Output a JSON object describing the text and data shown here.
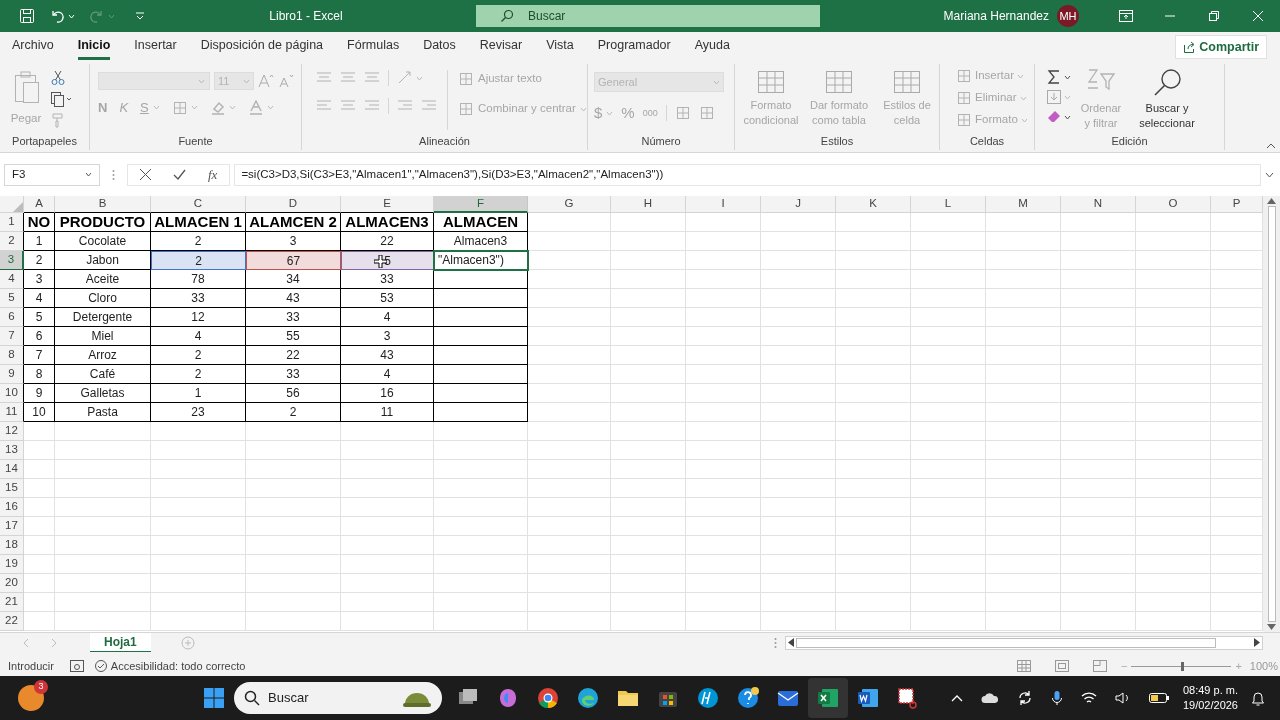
{
  "title_bar": {
    "title": "Libro1  -  Excel",
    "search_placeholder": "Buscar",
    "user": "Mariana Hernandez",
    "initials": "MH",
    "redo_disabled": true
  },
  "menu_tabs": [
    {
      "label": "Archivo",
      "selected": false
    },
    {
      "label": "Inicio",
      "selected": true
    },
    {
      "label": "Insertar",
      "selected": false
    },
    {
      "label": "Disposición de página",
      "selected": false
    },
    {
      "label": "Fórmulas",
      "selected": false
    },
    {
      "label": "Datos",
      "selected": false
    },
    {
      "label": "Revisar",
      "selected": false
    },
    {
      "label": "Vista",
      "selected": false
    },
    {
      "label": "Programador",
      "selected": false
    },
    {
      "label": "Ayuda",
      "selected": false
    }
  ],
  "share_button": "Compartir",
  "ribbon": {
    "groups": [
      {
        "label": "Portapapeles",
        "buttons": [
          {
            "label": "Pegar",
            "disabled": true
          }
        ]
      },
      {
        "label": "Fuente",
        "font_size": "11",
        "buttons": [
          {
            "label": "N",
            "disabled": true
          },
          {
            "label": "K",
            "disabled": true
          },
          {
            "label": "S",
            "disabled": true
          }
        ]
      },
      {
        "label": "Alineación",
        "buttons": [
          {
            "label": "Ajustar texto",
            "disabled": true
          },
          {
            "label": "Combinar y centrar",
            "disabled": true
          }
        ]
      },
      {
        "label": "Número",
        "format": "General",
        "buttons": [
          {
            "label": "$",
            "disabled": true
          },
          {
            "label": "%",
            "disabled": true
          },
          {
            "label": "000",
            "disabled": true
          }
        ]
      },
      {
        "label": "Estilos",
        "buttons": [
          {
            "label": "Formato condicional",
            "disabled": true
          },
          {
            "label": "Dar formato como tabla",
            "disabled": true
          },
          {
            "label": "Estilos de celda",
            "disabled": true
          }
        ]
      },
      {
        "label": "Celdas",
        "buttons": [
          {
            "label": "Insertar",
            "disabled": true
          },
          {
            "label": "Eliminar",
            "disabled": true
          },
          {
            "label": "Formato",
            "disabled": true
          }
        ]
      },
      {
        "label": "Edición",
        "buttons": [
          {
            "label": "Ordenar y filtrar",
            "disabled": true
          },
          {
            "label": "Buscar y seleccionar",
            "disabled": false
          }
        ]
      }
    ]
  },
  "formula_bar": {
    "name_box": "F3",
    "function_label": "fx",
    "formula": "=si(C3>D3,Si(C3>E3,\"Almacen1\",\"Almacen3\"),Si(D3>E3,\"Almacen2\",\"Almacen3\"))"
  },
  "grid": {
    "columns": [
      {
        "label": "A",
        "selected": false
      },
      {
        "label": "B",
        "selected": false
      },
      {
        "label": "C",
        "selected": false
      },
      {
        "label": "D",
        "selected": false
      },
      {
        "label": "E",
        "selected": false
      },
      {
        "label": "F",
        "selected": true
      },
      {
        "label": "G",
        "selected": false
      },
      {
        "label": "H",
        "selected": false
      },
      {
        "label": "I",
        "selected": false
      },
      {
        "label": "J",
        "selected": false
      },
      {
        "label": "K",
        "selected": false
      },
      {
        "label": "L",
        "selected": false
      },
      {
        "label": "M",
        "selected": false
      },
      {
        "label": "N",
        "selected": false
      },
      {
        "label": "O",
        "selected": false
      },
      {
        "label": "P",
        "selected": false
      }
    ],
    "rows": [
      {
        "header": "1",
        "selected": false,
        "kind": "heading",
        "cells": [
          {
            "text": "NO"
          },
          {
            "text": "PRODUCTO"
          },
          {
            "text": "ALMACEN 1"
          },
          {
            "text": "ALAMCEN 2"
          },
          {
            "text": "ALMACEN3"
          },
          {
            "text": "ALMACEN"
          }
        ]
      },
      {
        "header": "2",
        "selected": false,
        "kind": "data",
        "cells": [
          {
            "text": "1"
          },
          {
            "text": "Cocolate"
          },
          {
            "text": "2"
          },
          {
            "text": "3"
          },
          {
            "text": "22"
          },
          {
            "text": "Almacen3"
          }
        ]
      },
      {
        "header": "3",
        "selected": true,
        "kind": "data",
        "cells": [
          {
            "text": "2"
          },
          {
            "text": "Jabon"
          },
          {
            "text": "2",
            "color": "#4472c4"
          },
          {
            "text": "67",
            "color": "#c0504d"
          },
          {
            "text": "5",
            "color": "#8064a2"
          },
          {
            "text": "\"Almacen3\")"
          }
        ]
      },
      {
        "header": "4",
        "selected": false,
        "kind": "data",
        "cells": [
          {
            "text": "3"
          },
          {
            "text": "Aceite"
          },
          {
            "text": "78"
          },
          {
            "text": "34"
          },
          {
            "text": "33"
          }
        ]
      },
      {
        "header": "5",
        "selected": false,
        "kind": "data",
        "cells": [
          {
            "text": "4"
          },
          {
            "text": "Cloro"
          },
          {
            "text": "33"
          },
          {
            "text": "43"
          },
          {
            "text": "53"
          }
        ]
      },
      {
        "header": "6",
        "selected": false,
        "kind": "data",
        "cells": [
          {
            "text": "5"
          },
          {
            "text": "Detergente"
          },
          {
            "text": "12"
          },
          {
            "text": "33"
          },
          {
            "text": "4"
          }
        ]
      },
      {
        "header": "7",
        "selected": false,
        "kind": "data",
        "cells": [
          {
            "text": "6"
          },
          {
            "text": "Miel"
          },
          {
            "text": "4"
          },
          {
            "text": "55"
          },
          {
            "text": "3"
          }
        ]
      },
      {
        "header": "8",
        "selected": false,
        "kind": "data",
        "cells": [
          {
            "text": "7"
          },
          {
            "text": "Arroz"
          },
          {
            "text": "2"
          },
          {
            "text": "22"
          },
          {
            "text": "43"
          }
        ]
      },
      {
        "header": "9",
        "selected": false,
        "kind": "data",
        "cells": [
          {
            "text": "8"
          },
          {
            "text": "Café"
          },
          {
            "text": "2"
          },
          {
            "text": "33"
          },
          {
            "text": "4"
          }
        ]
      },
      {
        "header": "10",
        "selected": false,
        "kind": "data",
        "cells": [
          {
            "text": "9"
          },
          {
            "text": "Galletas"
          },
          {
            "text": "1"
          },
          {
            "text": "56"
          },
          {
            "text": "16"
          }
        ]
      },
      {
        "header": "11",
        "selected": false,
        "kind": "data",
        "cells": [
          {
            "text": "10"
          },
          {
            "text": "Pasta"
          },
          {
            "text": "23"
          },
          {
            "text": "2"
          },
          {
            "text": "11"
          }
        ]
      },
      {
        "header": "12",
        "selected": false,
        "kind": "empty"
      },
      {
        "header": "13",
        "selected": false,
        "kind": "empty"
      },
      {
        "header": "14",
        "selected": false,
        "kind": "empty"
      },
      {
        "header": "15",
        "selected": false,
        "kind": "empty"
      },
      {
        "header": "16",
        "selected": false,
        "kind": "empty"
      },
      {
        "header": "17",
        "selected": false,
        "kind": "empty"
      },
      {
        "header": "18",
        "selected": false,
        "kind": "empty"
      },
      {
        "header": "19",
        "selected": false,
        "kind": "empty"
      },
      {
        "header": "20",
        "selected": false,
        "kind": "empty"
      },
      {
        "header": "21",
        "selected": false,
        "kind": "empty"
      },
      {
        "header": "22",
        "selected": false,
        "kind": "empty"
      }
    ]
  },
  "sheet_tabs": [
    {
      "label": "Hoja1",
      "selected": true
    }
  ],
  "status_bar": {
    "mode": "Introducir",
    "accessibility": "Accesibilidad: todo correcto",
    "zoom": {
      "minus": "−",
      "plus": "+",
      "level": 0.5,
      "reading": "100%"
    }
  },
  "taskbar": {
    "weather_badge": "3",
    "search_placeholder": "Buscar",
    "time": "08:49 p. m.",
    "date": "19/02/2026"
  }
}
